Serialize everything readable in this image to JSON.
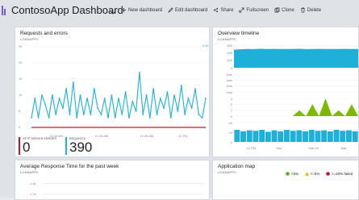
{
  "header": {
    "title": "ContosoApp Dashboard",
    "toolbar": [
      {
        "id": "new",
        "label": "New dashboard",
        "icon": "plus-icon"
      },
      {
        "id": "edit",
        "label": "Edit dashboard",
        "icon": "pencil-icon"
      },
      {
        "id": "share",
        "label": "Share",
        "icon": "share-icon"
      },
      {
        "id": "fullscreen",
        "label": "Fullscreen",
        "icon": "expand-icon"
      },
      {
        "id": "clone",
        "label": "Clone",
        "icon": "clone-icon"
      },
      {
        "id": "delete",
        "label": "Delete",
        "icon": "trash-icon"
      }
    ]
  },
  "requests_tile": {
    "title": "Requests and errors",
    "subtitle": "LOANAPP0",
    "y_ticks": [
      "25",
      "20",
      "15",
      "10",
      "5",
      "0"
    ],
    "x_ticks": [
      "11:15 AM",
      "11:30 AM",
      "11:45 AM",
      "12 PM"
    ],
    "unit_label": "0.81",
    "metrics": [
      {
        "label": "HTTP SERVER ERRORS",
        "value": "0",
        "color": "#c4142c"
      },
      {
        "label": "REQUESTS",
        "value": "390",
        "color": "#1db0d8"
      }
    ]
  },
  "overview_tile": {
    "title": "Overview timeline",
    "subtitle": "LOANAPP0",
    "y_ticks": [
      "300",
      "200",
      "100",
      "0",
      "6ms",
      "4ms",
      "2ms",
      "0ms",
      "3",
      "2",
      "1",
      "0",
      "40",
      "20",
      "0"
    ],
    "x_ticks": [
      "12 PM",
      "Mar",
      "Mar 24",
      "Mar"
    ]
  },
  "response_tile": {
    "title": "Average Response Time for the past week",
    "subtitle": "LOANAPP0",
    "y_ticks": [
      "1.4s",
      "1.2s"
    ]
  },
  "appmap_tile": {
    "title": "Application map",
    "subtitle": "LOANAPP0",
    "legend": [
      {
        "label": "<5%",
        "color": "#5ab024"
      },
      {
        "label": "<=5%",
        "color": "#f0a30a"
      },
      {
        "label": ">=20% failed",
        "color": "#c4142c"
      }
    ]
  },
  "chart_data": [
    {
      "type": "line",
      "title": "Requests and errors",
      "series": [
        {
          "name": "REQUESTS",
          "color": "#1db0d8",
          "values": [
            3,
            9,
            3,
            10,
            7,
            3,
            10,
            4,
            9,
            6,
            12,
            4,
            14,
            3,
            10,
            4,
            9,
            4,
            12,
            6,
            4,
            9,
            3,
            10,
            3,
            9,
            4,
            11,
            3,
            8,
            5,
            17,
            4,
            10,
            3,
            12,
            4,
            9,
            6,
            11,
            3,
            10,
            5,
            13,
            4,
            9,
            6,
            12,
            4,
            3,
            9
          ]
        },
        {
          "name": "HTTP SERVER ERRORS",
          "color": "#c4142c",
          "values": [
            0,
            0,
            0,
            0,
            0,
            0,
            0,
            0,
            0,
            0,
            0,
            0,
            0,
            0,
            0,
            0,
            0,
            0,
            0,
            0,
            0,
            0,
            0,
            0,
            0,
            0,
            0,
            0,
            0,
            0,
            0,
            0,
            0,
            0,
            0,
            0,
            0,
            0,
            0,
            0,
            0,
            0,
            0,
            0,
            0,
            0,
            0,
            0,
            0,
            0,
            0
          ]
        }
      ],
      "ylim": [
        0,
        25
      ]
    },
    {
      "type": "area",
      "title": "Overview timeline",
      "panels": [
        {
          "color": "#1db0d8",
          "values": [
            240,
            245,
            250,
            248,
            252,
            249,
            251,
            250,
            250,
            249,
            252,
            248,
            250,
            251,
            249,
            250,
            250,
            251,
            249,
            250
          ]
        },
        {
          "color": "#1db0d8",
          "values": [
            0,
            0,
            0,
            0,
            0,
            0,
            0,
            0,
            0,
            0,
            0,
            0,
            0,
            0,
            0,
            0,
            0,
            0,
            0,
            0
          ]
        },
        {
          "color": "#7cba00",
          "values": [
            0,
            0,
            0,
            0,
            0,
            0,
            0,
            0,
            0,
            0,
            1,
            0,
            2,
            0,
            3,
            0,
            1,
            0,
            2,
            0
          ]
        },
        {
          "color": "#1db0d8",
          "values": [
            25,
            22,
            24,
            23,
            25,
            21,
            24,
            22,
            25,
            23,
            24,
            22,
            25,
            23,
            24,
            22,
            25,
            23,
            24,
            22
          ]
        }
      ]
    }
  ]
}
